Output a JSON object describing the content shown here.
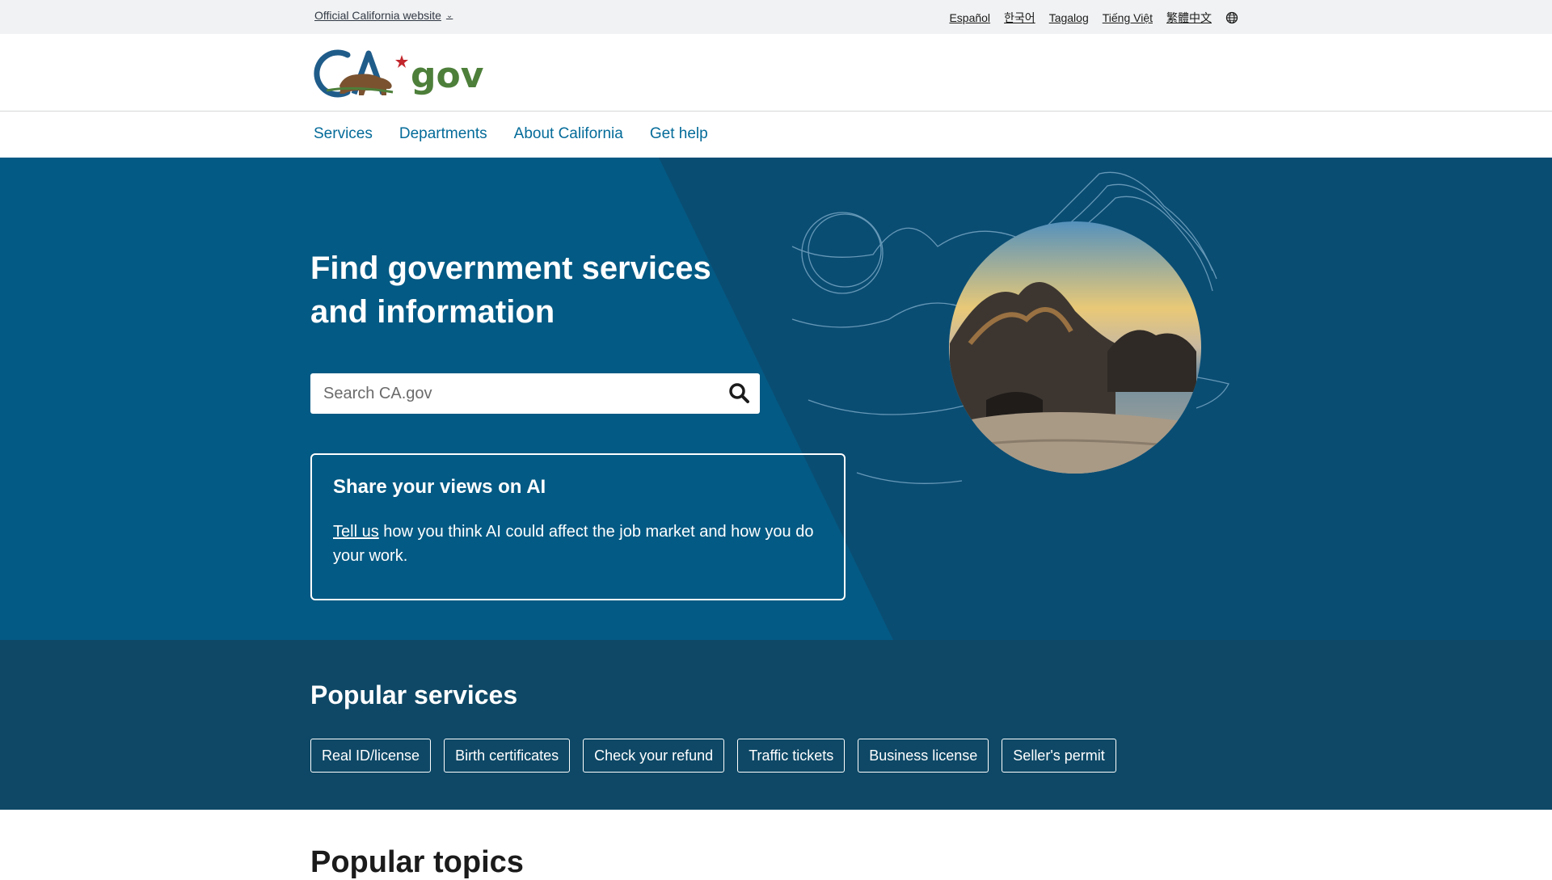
{
  "topbar": {
    "official_label": "Official California website",
    "languages": [
      "Español",
      "한국어",
      "Tagalog",
      "Tiếng Việt",
      "繁體中文"
    ]
  },
  "logo": {
    "text_ca": "CA",
    "text_gov": "gov"
  },
  "nav": {
    "items": [
      "Services",
      "Departments",
      "About California",
      "Get help"
    ]
  },
  "hero": {
    "title": "Find government services and information",
    "search_placeholder": "Search CA.gov",
    "ai_card": {
      "title": "Share your views on AI",
      "link_text": "Tell us",
      "body": " how you think AI could affect the job market and how you do your work."
    }
  },
  "popular_services": {
    "title": "Popular services",
    "items": [
      "Real ID/license",
      "Birth certificates",
      "Check your refund",
      "Traffic tickets",
      "Business license",
      "Seller's permit"
    ]
  },
  "popular_topics": {
    "title": "Popular topics"
  },
  "colors": {
    "hero_bg": "#035a84",
    "hero_wedge": "#0a4d73",
    "services_bg": "#0e4866",
    "nav_link": "#046b99",
    "logo_blue": "#1f5c8a",
    "logo_green": "#4d7f3a",
    "bear_brown": "#7a5230",
    "star_red": "#c2272d"
  }
}
